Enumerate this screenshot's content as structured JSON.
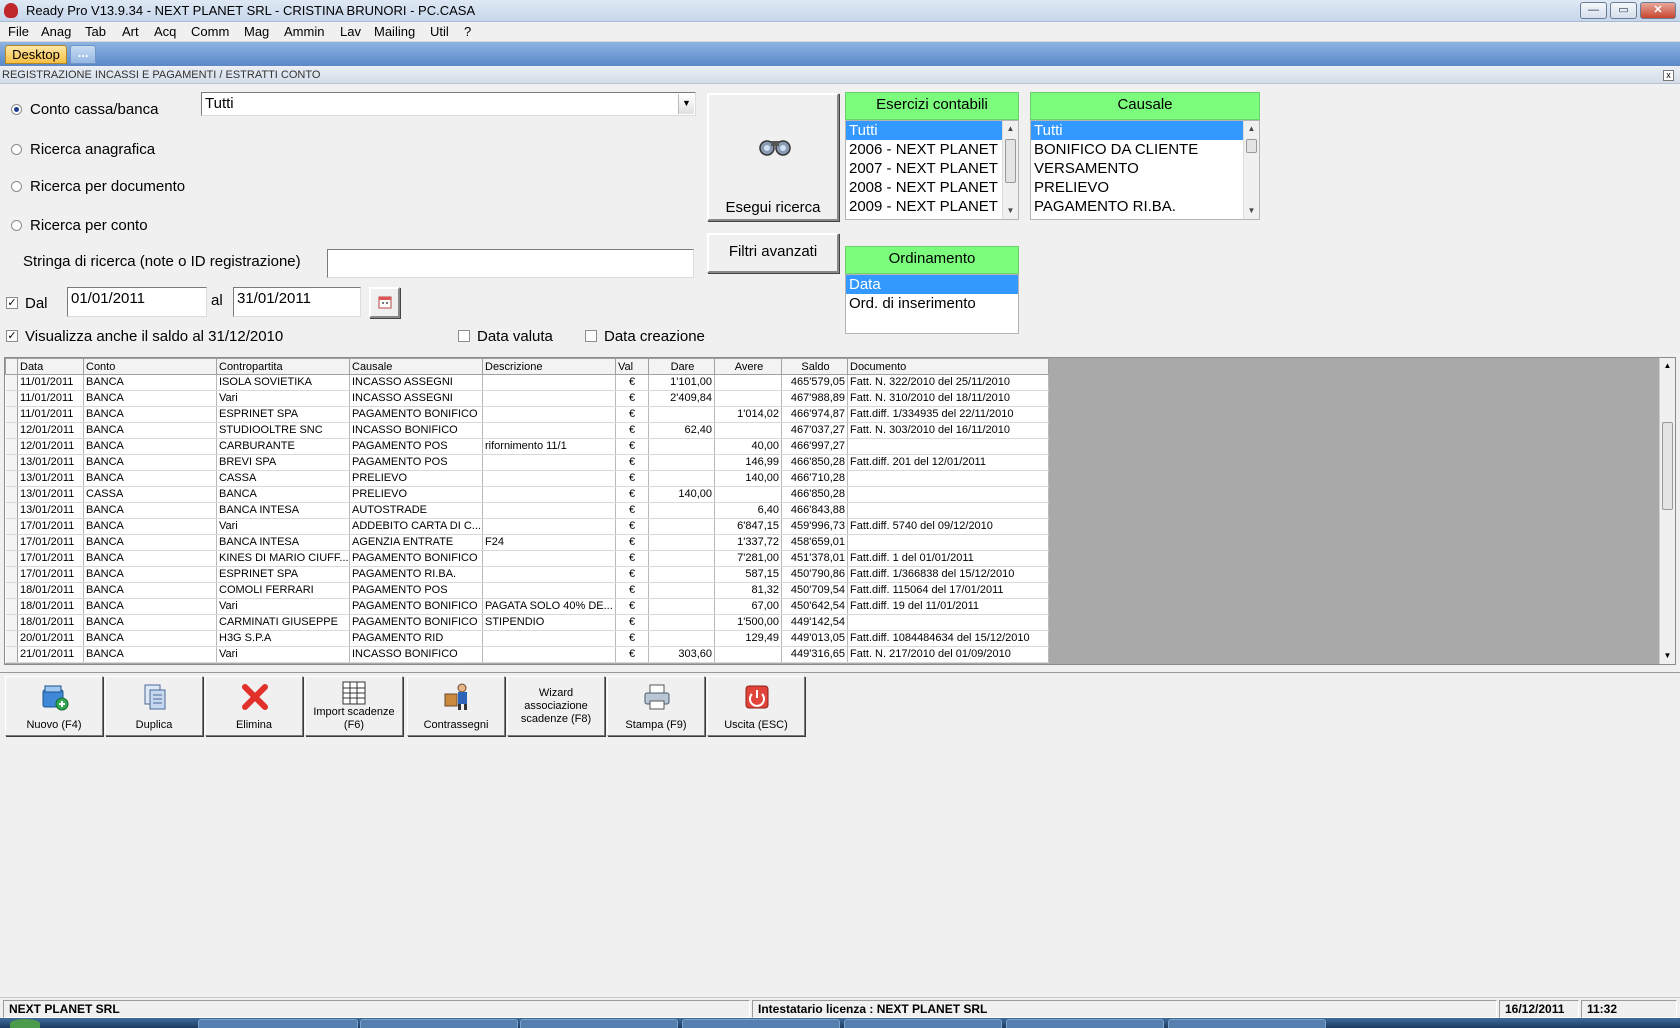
{
  "window": {
    "title": "Ready Pro V13.9.34 - NEXT PLANET SRL - CRISTINA BRUNORI - PC.CASA",
    "minimize": "—",
    "maximize": "▭",
    "close": "✕"
  },
  "menu": [
    "File",
    "Anag",
    "Tab",
    "Art",
    "Acq",
    "Comm",
    "Mag",
    "Ammin",
    "Lav",
    "Mailing",
    "Util",
    "?"
  ],
  "tabs": {
    "desktop": "Desktop",
    "more": "..."
  },
  "form": {
    "title": "REGISTRAZIONE INCASSI E PAGAMENTI / ESTRATTI CONTO",
    "close": "x"
  },
  "search": {
    "mode_conto": "Conto cassa/banca",
    "mode_anagrafica": "Ricerca anagrafica",
    "mode_documento": "Ricerca per documento",
    "mode_per_conto": "Ricerca per conto",
    "conto_value": "Tutti",
    "string_label": "Stringa di ricerca (note o ID registrazione)",
    "string_value": "",
    "dal_label": "Dal",
    "dal_value": "01/01/2011",
    "al_label": "al",
    "al_value": "31/01/2011",
    "saldo_label": "Visualizza anche il saldo al 31/12/2010",
    "data_valuta_label": "Data valuta",
    "data_creazione_label": "Data creazione",
    "esegui_label": "Esegui ricerca",
    "filtri_label": "Filtri avanzati",
    "checked_mark": "✓"
  },
  "esercizi": {
    "header": "Esercizi contabili",
    "items": [
      "Tutti",
      "2006 - NEXT PLANET",
      "2007 - NEXT PLANET",
      "2008 - NEXT PLANET",
      "2009 - NEXT PLANET"
    ]
  },
  "causale": {
    "header": "Causale",
    "items": [
      "Tutti",
      "BONIFICO DA CLIENTE",
      "VERSAMENTO",
      "PRELIEVO",
      "PAGAMENTO RI.BA."
    ]
  },
  "ordinamento": {
    "header": "Ordinamento",
    "items": [
      "Data",
      "Ord. di inserimento"
    ]
  },
  "grid": {
    "columns": [
      "Data",
      "Conto",
      "Contropartita",
      "Causale",
      "Descrizione",
      "Val",
      "Dare",
      "Avere",
      "Saldo",
      "Documento"
    ],
    "rows": [
      [
        "11/01/2011",
        "BANCA",
        "ISOLA SOVIETIKA",
        "INCASSO ASSEGNI",
        "",
        "€",
        "1'101,00",
        "",
        "465'579,05",
        "Fatt. N. 322/2010 del 25/11/2010"
      ],
      [
        "11/01/2011",
        "BANCA",
        "Vari",
        "INCASSO ASSEGNI",
        "",
        "€",
        "2'409,84",
        "",
        "467'988,89",
        "Fatt. N. 310/2010 del 18/11/2010"
      ],
      [
        "11/01/2011",
        "BANCA",
        "ESPRINET SPA",
        "PAGAMENTO BONIFICO",
        "",
        "€",
        "",
        "1'014,02",
        "466'974,87",
        "Fatt.diff. 1/334935 del 22/11/2010"
      ],
      [
        "12/01/2011",
        "BANCA",
        "STUDIOOLTRE SNC",
        "INCASSO BONIFICO",
        "",
        "€",
        "62,40",
        "",
        "467'037,27",
        "Fatt. N. 303/2010 del 16/11/2010"
      ],
      [
        "12/01/2011",
        "BANCA",
        "CARBURANTE",
        "PAGAMENTO POS",
        "rifornimento 11/1",
        "€",
        "",
        "40,00",
        "466'997,27",
        ""
      ],
      [
        "13/01/2011",
        "BANCA",
        "BREVI SPA",
        "PAGAMENTO POS",
        "",
        "€",
        "",
        "146,99",
        "466'850,28",
        "Fatt.diff. 201 del 12/01/2011"
      ],
      [
        "13/01/2011",
        "BANCA",
        "CASSA",
        "PRELIEVO",
        "",
        "€",
        "",
        "140,00",
        "466'710,28",
        ""
      ],
      [
        "13/01/2011",
        "CASSA",
        "BANCA",
        "PRELIEVO",
        "",
        "€",
        "140,00",
        "",
        "466'850,28",
        ""
      ],
      [
        "13/01/2011",
        "BANCA",
        "BANCA INTESA",
        "AUTOSTRADE",
        "",
        "€",
        "",
        "6,40",
        "466'843,88",
        ""
      ],
      [
        "17/01/2011",
        "BANCA",
        "Vari",
        "ADDEBITO CARTA DI C...",
        "",
        "€",
        "",
        "6'847,15",
        "459'996,73",
        "Fatt.diff. 5740 del 09/12/2010"
      ],
      [
        "17/01/2011",
        "BANCA",
        "BANCA INTESA",
        "AGENZIA ENTRATE",
        "F24",
        "€",
        "",
        "1'337,72",
        "458'659,01",
        ""
      ],
      [
        "17/01/2011",
        "BANCA",
        "KINES DI MARIO CIUFF...",
        "PAGAMENTO BONIFICO",
        "",
        "€",
        "",
        "7'281,00",
        "451'378,01",
        "Fatt.diff. 1 del 01/01/2011"
      ],
      [
        "17/01/2011",
        "BANCA",
        "ESPRINET SPA",
        "PAGAMENTO RI.BA.",
        "",
        "€",
        "",
        "587,15",
        "450'790,86",
        "Fatt.diff. 1/366838 del 15/12/2010"
      ],
      [
        "18/01/2011",
        "BANCA",
        "COMOLI FERRARI",
        "PAGAMENTO POS",
        "",
        "€",
        "",
        "81,32",
        "450'709,54",
        "Fatt.diff. 115064 del 17/01/2011"
      ],
      [
        "18/01/2011",
        "BANCA",
        "Vari",
        "PAGAMENTO BONIFICO",
        "PAGATA SOLO 40% DE...",
        "€",
        "",
        "67,00",
        "450'642,54",
        "Fatt.diff. 19 del 11/01/2011"
      ],
      [
        "18/01/2011",
        "BANCA",
        "CARMINATI GIUSEPPE",
        "PAGAMENTO BONIFICO",
        "STIPENDIO",
        "€",
        "",
        "1'500,00",
        "449'142,54",
        ""
      ],
      [
        "20/01/2011",
        "BANCA",
        "H3G S.P.A",
        "PAGAMENTO RID",
        "",
        "€",
        "",
        "129,49",
        "449'013,05",
        "Fatt.diff. 1084484634 del 15/12/2010"
      ],
      [
        "21/01/2011",
        "BANCA",
        "Vari",
        "INCASSO BONIFICO",
        "",
        "€",
        "303,60",
        "",
        "449'316,65",
        "Fatt. N. 217/2010 del 01/09/2010"
      ]
    ]
  },
  "toolbar": {
    "nuovo": "Nuovo (F4)",
    "duplica": "Duplica",
    "elimina": "Elimina",
    "import": "Import scadenze (F6)",
    "contrassegni": "Contrassegni",
    "wizard": "Wizard associazione scadenze (F8)",
    "stampa": "Stampa (F9)",
    "uscita": "Uscita (ESC)"
  },
  "status": {
    "company": "NEXT PLANET SRL",
    "license": "Intestatario licenza : NEXT PLANET SRL",
    "date": "16/12/2011",
    "time": "11:32"
  },
  "colors": {
    "list_header": "#7cfc7c",
    "selection": "#3399ff",
    "tab_active": "#f6bf43"
  }
}
